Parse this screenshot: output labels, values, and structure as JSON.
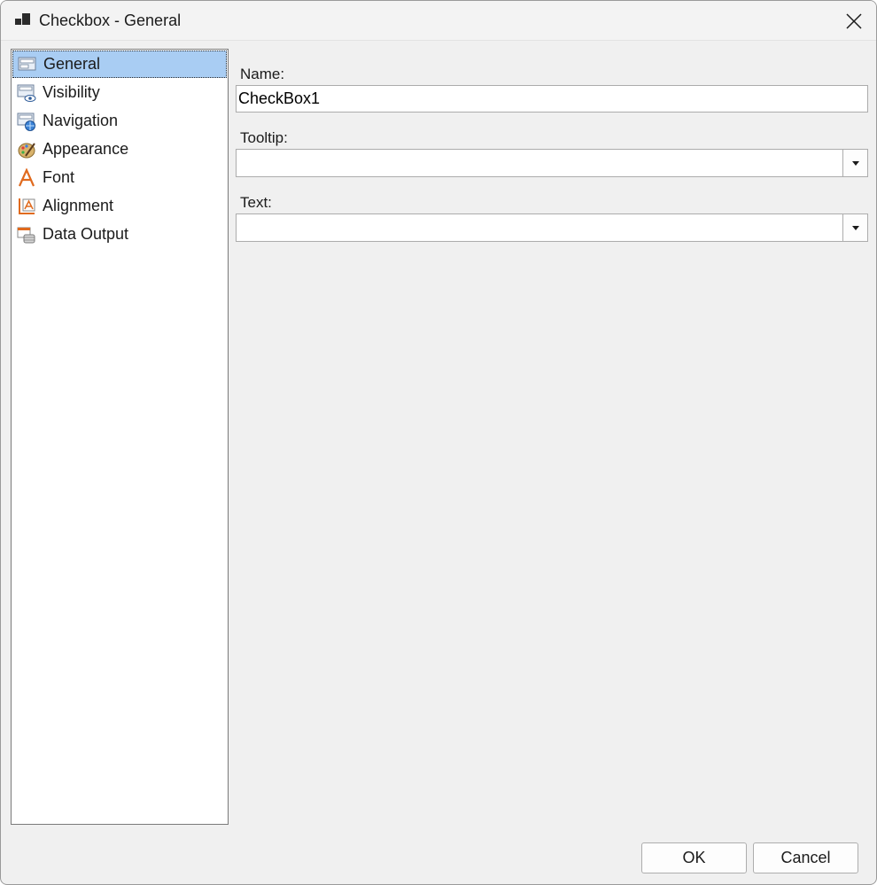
{
  "window": {
    "title": "Checkbox - General"
  },
  "nav": {
    "items": [
      {
        "label": "General",
        "icon": "general-icon",
        "selected": true
      },
      {
        "label": "Visibility",
        "icon": "visibility-icon",
        "selected": false
      },
      {
        "label": "Navigation",
        "icon": "navigation-icon",
        "selected": false
      },
      {
        "label": "Appearance",
        "icon": "appearance-icon",
        "selected": false
      },
      {
        "label": "Font",
        "icon": "font-icon",
        "selected": false
      },
      {
        "label": "Alignment",
        "icon": "alignment-icon",
        "selected": false
      },
      {
        "label": "Data Output",
        "icon": "data-output-icon",
        "selected": false
      }
    ]
  },
  "form": {
    "name_label": "Name:",
    "name_value": "CheckBox1",
    "tooltip_label": "Tooltip:",
    "tooltip_value": "",
    "text_label": "Text:",
    "text_value": ""
  },
  "buttons": {
    "ok": "OK",
    "cancel": "Cancel"
  },
  "colors": {
    "selection": "#a9cdf3",
    "window_bg": "#f0f0f0"
  }
}
